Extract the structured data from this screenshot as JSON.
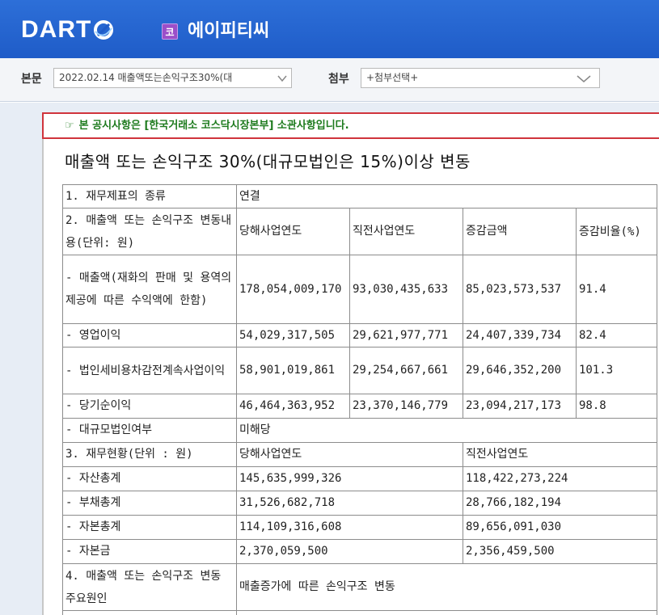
{
  "header": {
    "logo_text": "DART",
    "market_badge": "코",
    "company_name": "에이피티씨"
  },
  "toolbar": {
    "body_label": "본문",
    "body_select_value": "2022.02.14  매출액또는손익구조30%(대",
    "attach_label": "첨부",
    "attach_select_value": "+첨부선택+"
  },
  "notice": {
    "icon": "hand-pointer-icon",
    "text": "본 공시사항은 [한국거래소 코스닥시장본부] 소관사항입니다."
  },
  "document": {
    "title": "매출액 또는 손익구조 30%(대규모법인은 15%)이상 변동",
    "table": {
      "r1": {
        "label": "1. 재무제표의 종류",
        "value": "연결"
      },
      "r2": {
        "label": "2. 매출액 또는 손익구조 변동내용(단위: 원)",
        "h_current": "당해사업연도",
        "h_prev": "직전사업연도",
        "h_change": "증감금액",
        "h_rate": "증감비율(%)"
      },
      "rows": [
        {
          "label": "- 매출액(재화의 판매 및 용역의 제공에 따른 수익액에 한함)",
          "current": "178,054,009,170",
          "prev": "93,030,435,633",
          "change": "85,023,573,537",
          "rate": "91.4"
        },
        {
          "label": "- 영업이익",
          "current": "54,029,317,505",
          "prev": "29,621,977,771",
          "change": "24,407,339,734",
          "rate": "82.4"
        },
        {
          "label": "- 법인세비용차감전계속사업이익",
          "current": "58,901,019,861",
          "prev": "29,254,667,661",
          "change": "29,646,352,200",
          "rate": "101.3"
        },
        {
          "label": "- 당기순이익",
          "current": "46,464,363,952",
          "prev": "23,370,146,779",
          "change": "23,094,217,173",
          "rate": "98.8"
        }
      ],
      "large_corp": {
        "label": "- 대규모법인여부",
        "value": "미해당"
      },
      "r3": {
        "label": "3. 재무현황(단위 : 원)",
        "h_current": "당해사업연도",
        "h_prev": "직전사업연도"
      },
      "status_rows": [
        {
          "label": "- 자산총계",
          "current": "145,635,999,326",
          "prev": "118,422,273,224"
        },
        {
          "label": "- 부채총계",
          "current": "31,526,682,718",
          "prev": "28,766,182,194"
        },
        {
          "label": "- 자본총계",
          "current": "114,109,316,608",
          "prev": "89,656,091,030"
        },
        {
          "label": "- 자본금",
          "current": "2,370,059,500",
          "prev": "2,356,459,500"
        }
      ],
      "r4": {
        "label": "4. 매출액 또는 손익구조 변동 주요원인",
        "value": "매출증가에 따른 손익구조 변동"
      }
    }
  }
}
